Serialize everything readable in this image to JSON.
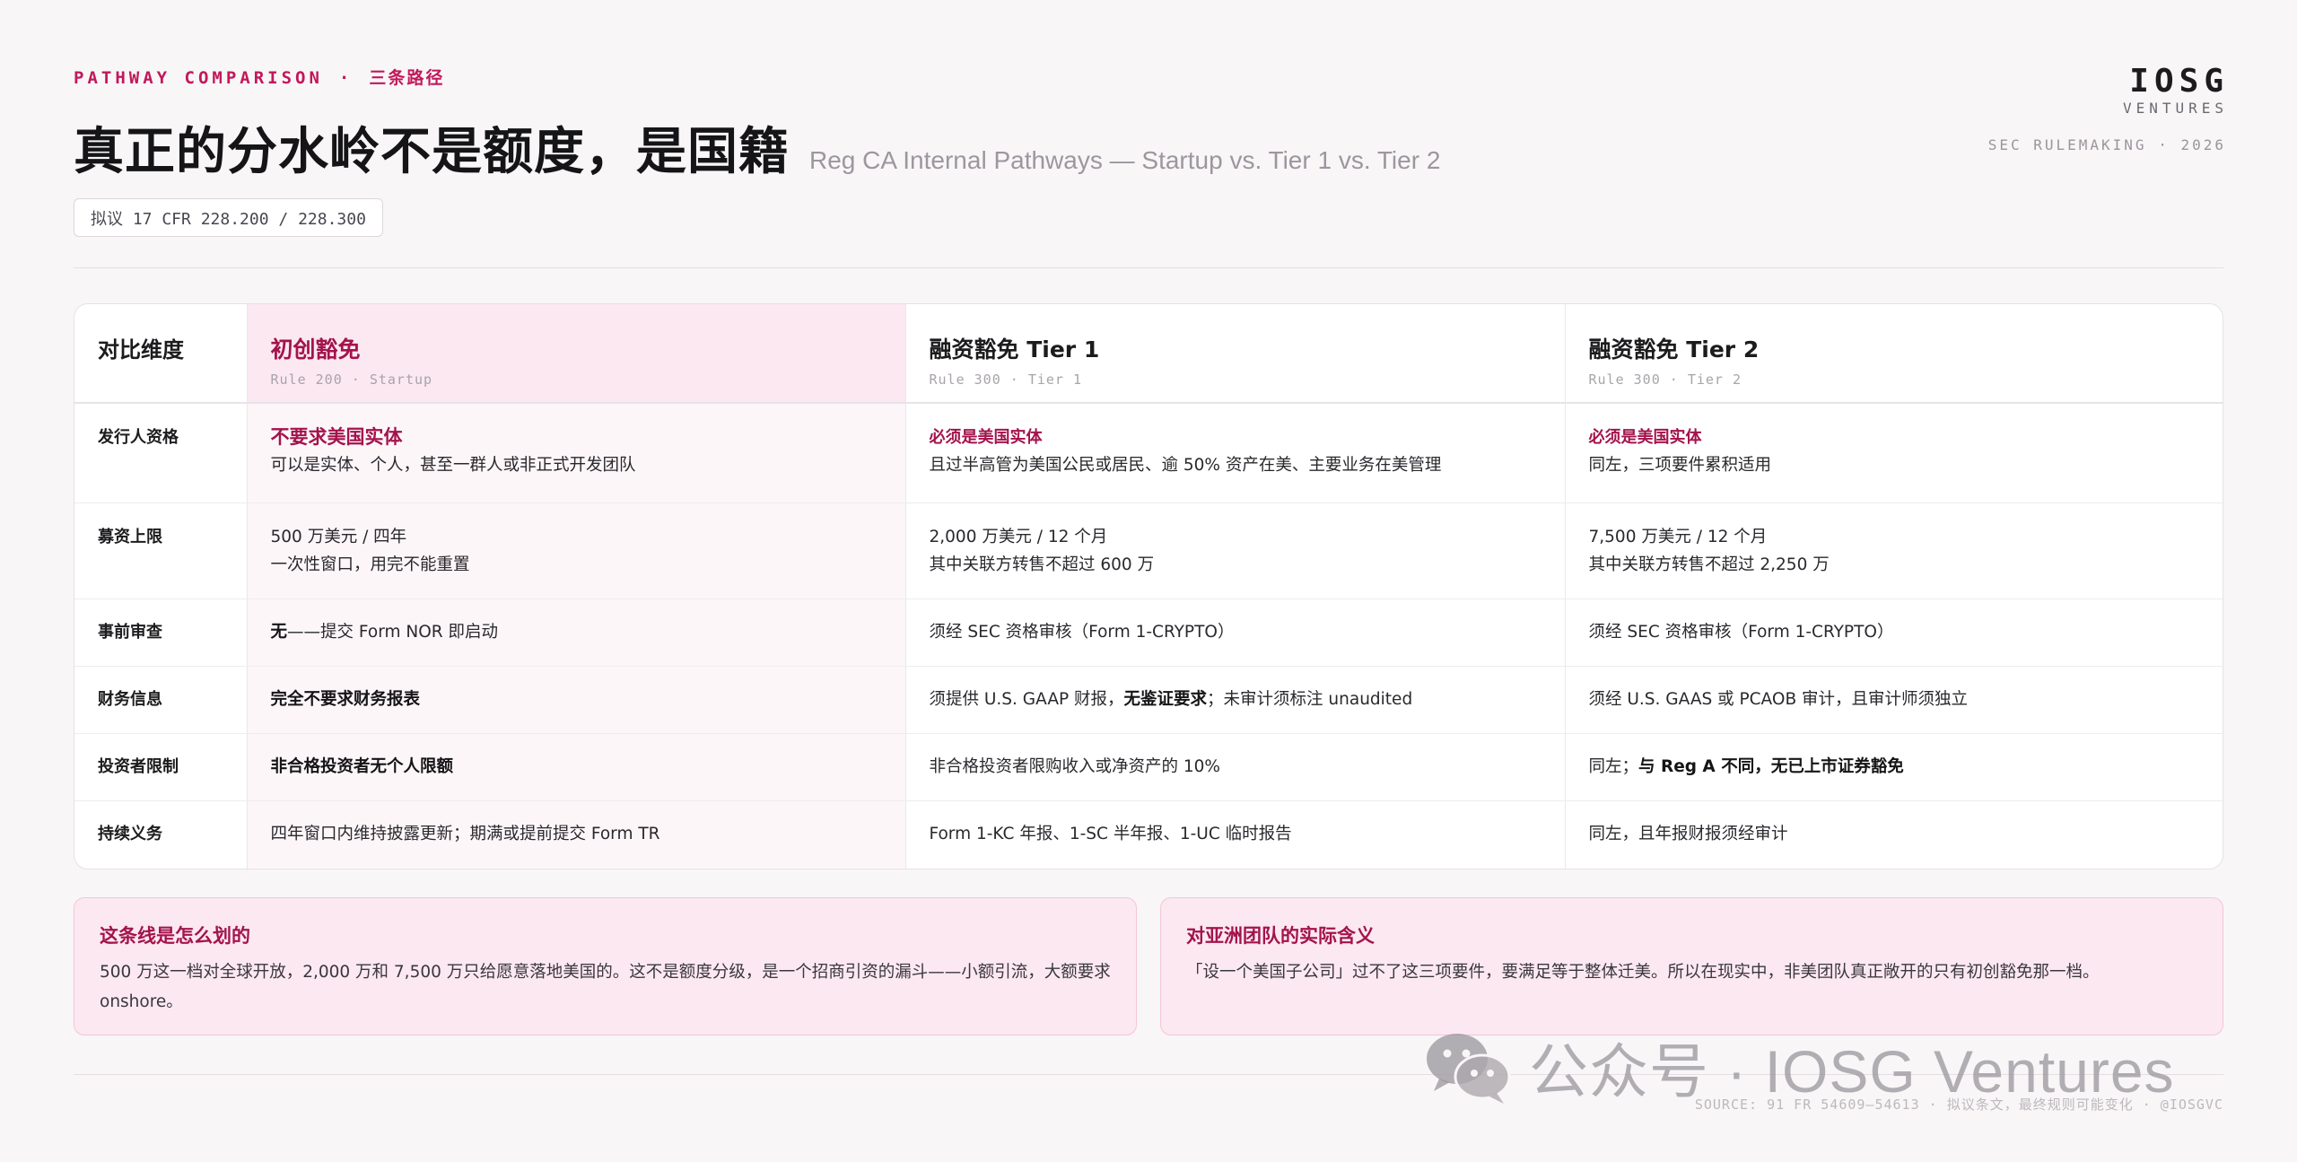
{
  "header": {
    "eyebrow_en": "PATHWAY COMPARISON",
    "eyebrow_sep": "·",
    "eyebrow_zh": "三条路径",
    "title": "真正的分水岭不是额度，是国籍",
    "subtitle": "Reg CA Internal Pathways — Startup vs. Tier 1 vs. Tier 2",
    "tag": "拟议 17 CFR 228.200 / 228.300"
  },
  "brand": {
    "logo": "IOSG",
    "ventures": "VENTURES",
    "rule": "SEC RULEMAKING · 2026"
  },
  "table": {
    "dim_label": "对比维度",
    "columns": [
      {
        "title": "初创豁免",
        "sub": "Rule 200 · Startup"
      },
      {
        "title": "融资豁免 Tier 1",
        "sub": "Rule 300 · Tier 1"
      },
      {
        "title": "融资豁免 Tier 2",
        "sub": "Rule 300 · Tier 2"
      }
    ],
    "rows": [
      {
        "label": "发行人资格",
        "c1_em": "不要求美国实体",
        "c1_text": "可以是实体、个人，甚至一群人或非正式开发团队",
        "c2_em": "必须是美国实体",
        "c2_text": "且过半高管为美国公民或居民、逾 50% 资产在美、主要业务在美管理",
        "c3_em": "必须是美国实体",
        "c3_text": "同左，三项要件累积适用"
      },
      {
        "label": "募资上限",
        "c1_l1": "500 万美元 / 四年",
        "c1_l2": "一次性窗口，用完不能重置",
        "c2_l1": "2,000 万美元 / 12 个月",
        "c2_l2": "其中关联方转售不超过 600 万",
        "c3_l1": "7,500 万美元 / 12 个月",
        "c3_l2": "其中关联方转售不超过 2,250 万"
      },
      {
        "label": "事前审查",
        "c1_em": "无",
        "c1_text": "——提交 Form NOR 即启动",
        "c2": "须经 SEC 资格审核（Form 1-CRYPTO）",
        "c3": "须经 SEC 资格审核（Form 1-CRYPTO）"
      },
      {
        "label": "财务信息",
        "c1_em": "完全不要求财务报表",
        "c2_pre": "须提供 U.S. GAAP 财报，",
        "c2_em": "无鉴证要求",
        "c2_post": "；未审计须标注 unaudited",
        "c3": "须经 U.S. GAAS 或 PCAOB 审计，且审计师须独立"
      },
      {
        "label": "投资者限制",
        "c1_em": "非合格投资者无个人限额",
        "c2": "非合格投资者限购收入或净资产的 10%",
        "c3_pre": "同左；",
        "c3_em": "与 Reg A 不同，无已上市证券豁免"
      },
      {
        "label": "持续义务",
        "c1": "四年窗口内维持披露更新；期满或提前提交 Form TR",
        "c2": "Form 1-KC 年报、1-SC 半年报、1-UC 临时报告",
        "c3": "同左，且年报财报须经审计"
      }
    ]
  },
  "notes": [
    {
      "title": "这条线是怎么划的",
      "body": "500 万这一档对全球开放，2,000 万和 7,500 万只给愿意落地美国的。这不是额度分级，是一个招商引资的漏斗——小额引流，大额要求 onshore。"
    },
    {
      "title": "对亚洲团队的实际含义",
      "body": "「设一个美国子公司」过不了这三项要件，要满足等于整体迁美。所以在现实中，非美团队真正敞开的只有初创豁免那一档。"
    }
  ],
  "footer": "SOURCE: 91 FR 54609–54613 · 拟议条文，最终规则可能变化 · @IOSGVC",
  "watermark": "公众号 · IOSG Ventures",
  "colors": {
    "accent": "#c2185b",
    "accent_dark": "#a3134c",
    "highlight_bg": "#fce8f1",
    "page_bg": "#f8f6f7"
  }
}
